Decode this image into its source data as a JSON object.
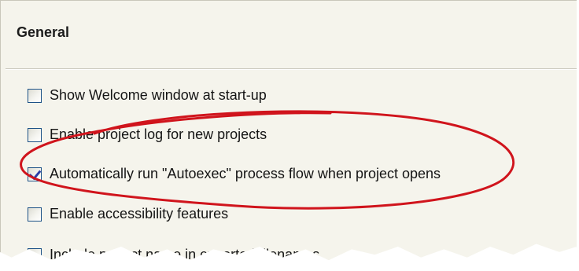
{
  "section": {
    "title": "General"
  },
  "options": [
    {
      "label": "Show Welcome window at start-up",
      "checked": false
    },
    {
      "label": "Enable project log for new projects",
      "checked": false
    },
    {
      "label": "Automatically run \"Autoexec\" process flow when project opens",
      "checked": true
    },
    {
      "label": "Enable accessibility features",
      "checked": false
    },
    {
      "label": "Include project name in exported filenames",
      "checked": false
    }
  ],
  "colors": {
    "panel_bg": "#f5f4ec",
    "annotation_ellipse": "#d0141c",
    "checkbox_border": "#1d5287",
    "checkmark": "#2a3fa8"
  },
  "annotation": {
    "type": "hand-drawn-ellipse",
    "target": "Automatically run \"Autoexec\" process flow when project opens"
  }
}
